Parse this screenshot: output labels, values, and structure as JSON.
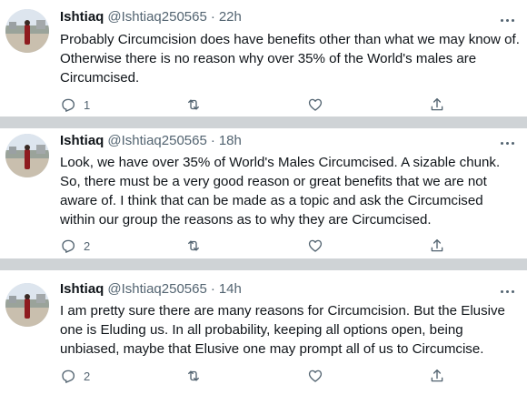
{
  "tweets": [
    {
      "author": "Ishtiaq",
      "handle": "@Ishtiaq250565",
      "separator": "·",
      "time": "22h",
      "lines": [
        "Probably Circumcision does have benefits other than what we may know of.",
        "Otherwise there is no reason why over 35% of the World's males are",
        "Circumcised."
      ],
      "reply_count": "1"
    },
    {
      "author": "Ishtiaq",
      "handle": "@Ishtiaq250565",
      "separator": "·",
      "time": "18h",
      "lines": [
        "Look, we have over 35% of World's Males Circumcised. A sizable chunk.",
        "So, there must be a very good reason or great benefits that we are not",
        "aware of. I think that can be made as a topic and ask the Circumcised",
        "within our group the reasons as to why they are Circumcised."
      ],
      "reply_count": "2"
    },
    {
      "author": "Ishtiaq",
      "handle": "@Ishtiaq250565",
      "separator": "·",
      "time": "14h",
      "lines": [
        "I am pretty sure there are many reasons for Circumcision. But the Elusive",
        "one is Eluding us. In all probability, keeping all options open, being",
        "unbiased, maybe that Elusive one may prompt all of us to Circumcise."
      ],
      "reply_count": "2"
    }
  ],
  "icons": {
    "reply": "reply-icon",
    "retweet": "retweet-icon",
    "like": "like-icon",
    "share": "share-icon",
    "more": "more-icon"
  },
  "colors": {
    "text": "#0f1419",
    "secondary": "#536471",
    "separator": "#cfd3d6"
  }
}
